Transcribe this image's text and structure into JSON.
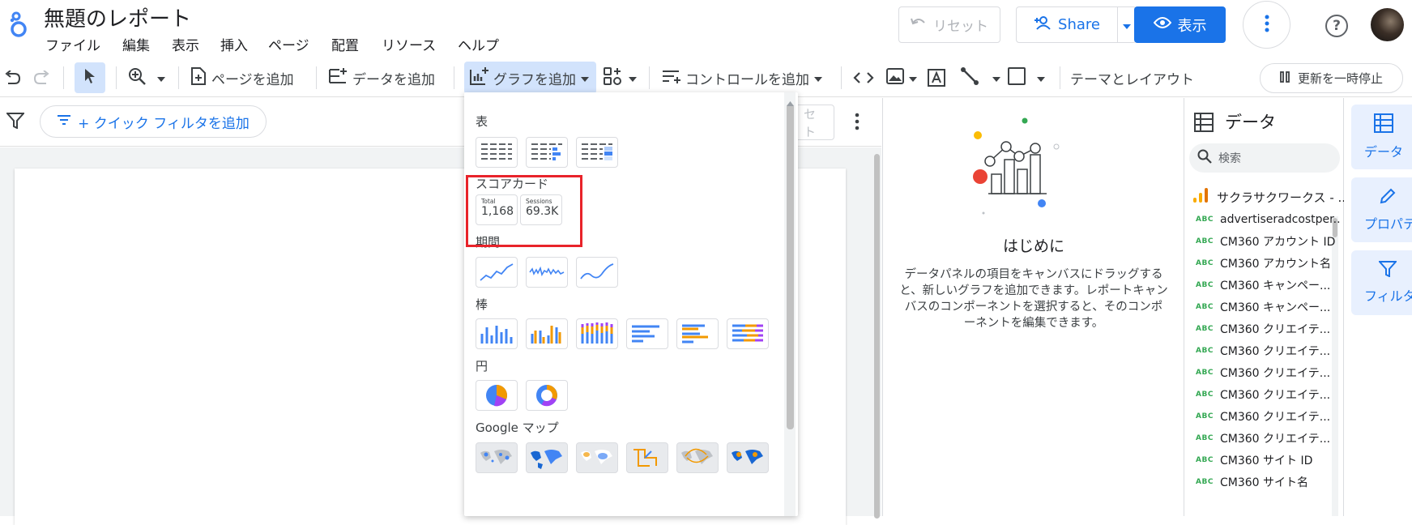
{
  "app": {
    "title": "無題のレポート"
  },
  "menu": [
    "ファイル",
    "編集",
    "表示",
    "挿入",
    "ページ",
    "配置",
    "リソース",
    "ヘルプ"
  ],
  "header": {
    "reset_label": "リセット",
    "share_label": "Share",
    "view_label": "表示"
  },
  "toolbar": {
    "add_page": "ページを追加",
    "add_data": "データを追加",
    "add_chart": "グラフを追加",
    "add_control": "コントロールを追加",
    "theme_layout": "テーマとレイアウト",
    "pause_update": "更新を一時停止"
  },
  "filterbar": {
    "quick_filter": "+ クイック フィルタを追加",
    "partial_reset": "セ\nト"
  },
  "chart_menu": {
    "sections": {
      "table": "表",
      "scorecard": "スコアカード",
      "timeseries": "期間",
      "bar": "棒",
      "pie": "円",
      "geo": "Google マップ"
    },
    "scorecards": [
      {
        "label": "Total",
        "value": "1,168"
      },
      {
        "label": "Sessions",
        "value": "69.3K"
      }
    ]
  },
  "help_panel": {
    "heading": "はじめに",
    "body": "データパネルの項目をキャンバスにドラッグすると、新しいグラフを追加できます。レポートキャンバスのコンポーネントを選択すると、そのコンポーネントを編集できます。"
  },
  "data_panel": {
    "title": "データ",
    "search_placeholder": "検索",
    "source_name": "サクラサクワークス - ...",
    "field_type": "ABC",
    "fields": [
      "advertiseradcostper...",
      "CM360 アカウント ID",
      "CM360 アカウント名",
      "CM360 キャンペー...",
      "CM360 キャンペー...",
      "CM360 クリエイテ...",
      "CM360 クリエイテ...",
      "CM360 クリエイテ...",
      "CM360 クリエイテ...",
      "CM360 クリエイテ...",
      "CM360 クリエイテ...",
      "CM360 サイト ID",
      "CM360 サイト名"
    ]
  },
  "rail": {
    "data": "データ",
    "properties": "プロパティ",
    "filter": "フィルタバー"
  },
  "colors": {
    "accent": "#1a73e8",
    "selected_bg": "#d2e3fc",
    "highlight": "#e8232a",
    "field_type": "#34a853"
  }
}
